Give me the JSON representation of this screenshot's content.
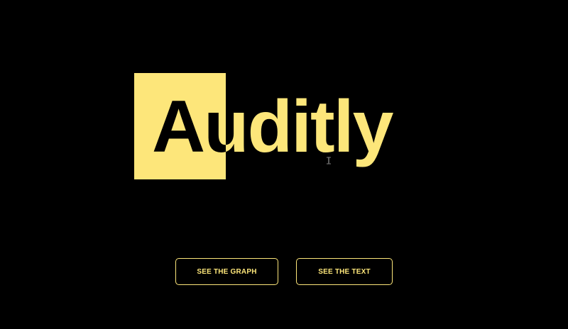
{
  "logo": {
    "text": "Auditly",
    "accent_color": "#fde67a",
    "background_color": "#000000"
  },
  "actions": {
    "graph_label": "SEE THE GRAPH",
    "text_label": "SEE THE TEXT"
  },
  "cursor": {
    "icon": "text-cursor-icon"
  }
}
